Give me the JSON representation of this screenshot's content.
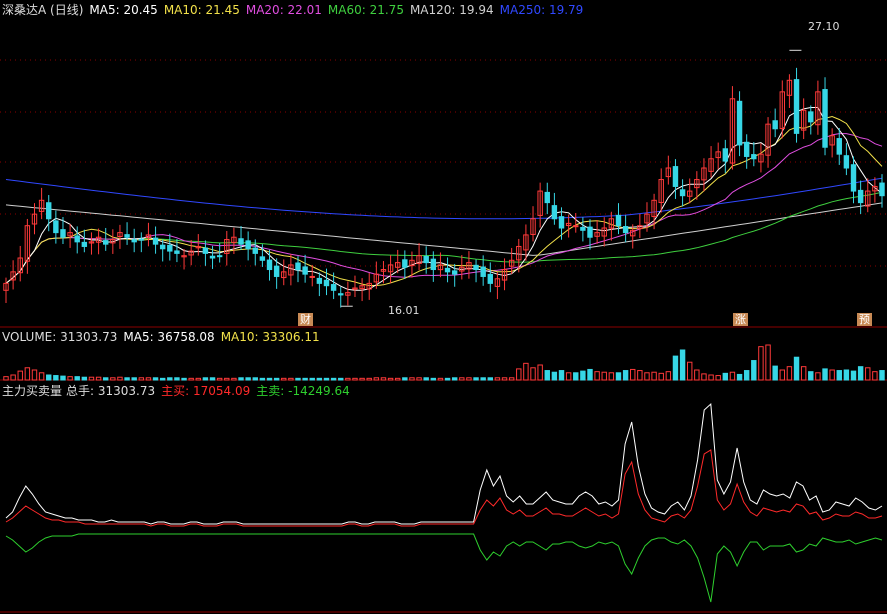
{
  "colors": {
    "bg": "#000000",
    "grid": "#8b0000",
    "up": "#ff3a3a",
    "down": "#37d7e6",
    "ma5": "#ffffff",
    "ma10": "#f2e14a",
    "ma20": "#e04ee0",
    "ma60": "#3fcf3f",
    "ma120": "#cfcfcf",
    "ma250": "#3048ff",
    "buy": "#ff2a2a",
    "sell": "#2ecf2e",
    "total": "#ffffff",
    "marker_bg": "#c88a55",
    "marker_text": "#ffffff"
  },
  "price_panel": {
    "title": "深桑达A (日线)",
    "ma5": "MA5: 20.45",
    "ma10": "MA10: 21.45",
    "ma20": "MA20: 22.01",
    "ma60": "MA60: 21.75",
    "ma120": "MA120: 19.94",
    "ma250": "MA250: 19.79",
    "high_label": "27.10",
    "low_label": "16.01",
    "markers": [
      "财",
      "涨",
      "预"
    ]
  },
  "volume_panel": {
    "label": "VOLUME: 31303.73",
    "ma5": "MA5: 36758.08",
    "ma10": "MA10: 33306.11"
  },
  "flow_panel": {
    "label": "主力买卖量",
    "total": "总手: 31303.73",
    "buy": "主买: 17054.09",
    "sell": "主卖: -14249.64"
  },
  "chart_data": [
    {
      "type": "candlestick",
      "title": "深桑达A (日线)",
      "approx_price_range": [
        15.5,
        28.5
      ],
      "close": [
        17.0,
        17.5,
        18.1,
        19.5,
        20.0,
        20.6,
        19.8,
        19.2,
        19.0,
        19.2,
        18.8,
        18.6,
        18.8,
        19.0,
        18.7,
        18.9,
        19.2,
        19.0,
        18.8,
        18.9,
        19.1,
        18.7,
        18.5,
        18.4,
        18.3,
        18.2,
        18.4,
        18.6,
        18.3,
        18.1,
        18.2,
        18.9,
        19.0,
        18.7,
        18.5,
        18.3,
        18.0,
        17.6,
        17.3,
        17.5,
        17.8,
        17.6,
        17.4,
        17.3,
        17.0,
        16.9,
        16.7,
        16.5,
        16.6,
        16.8,
        16.9,
        17.0,
        17.4,
        17.6,
        17.8,
        17.9,
        17.7,
        18.0,
        18.2,
        17.9,
        17.6,
        17.8,
        17.5,
        17.4,
        17.7,
        17.9,
        17.6,
        17.3,
        17.0,
        17.2,
        17.6,
        18.0,
        18.6,
        19.1,
        19.8,
        21.0,
        20.5,
        19.8,
        19.4,
        19.6,
        19.5,
        19.3,
        19.0,
        19.2,
        19.4,
        19.8,
        19.5,
        19.2,
        19.3,
        19.5,
        20.0,
        20.6,
        21.5,
        22.0,
        21.2,
        20.8,
        21.0,
        21.5,
        22.0,
        22.4,
        22.7,
        22.3,
        25.0,
        23.0,
        22.5,
        22.4,
        22.6,
        23.9,
        23.7,
        25.3,
        25.8,
        23.5,
        24.5,
        24.0,
        25.3,
        22.9,
        23.4,
        22.6,
        22.0,
        21.0,
        20.5,
        21.0,
        21.2,
        20.8
      ],
      "high_marker": 27.1,
      "low_marker": 16.01
    },
    {
      "type": "line",
      "title": "主力买卖量",
      "series": [
        {
          "name": "总手",
          "values": [
            6,
            9,
            16,
            22,
            18,
            13,
            9,
            8,
            7,
            6,
            6,
            5,
            5,
            5,
            4,
            4,
            5,
            4,
            4,
            4,
            4,
            4,
            3,
            4,
            4,
            3,
            3,
            3,
            4,
            4,
            3,
            3,
            3,
            4,
            4,
            4,
            3,
            3,
            3,
            3,
            3,
            3,
            3,
            3,
            3,
            3,
            3,
            3,
            3,
            3,
            3,
            3,
            4,
            4,
            3,
            3,
            4,
            4,
            4,
            4,
            3,
            3,
            3,
            4,
            4,
            4,
            4,
            4,
            4,
            4,
            4,
            4,
            20,
            30,
            22,
            27,
            17,
            14,
            17,
            13,
            13,
            16,
            19,
            15,
            14,
            13,
            13,
            17,
            19,
            17,
            13,
            14,
            12,
            15,
            43,
            54,
            32,
            18,
            11,
            9,
            8,
            12,
            14,
            10,
            17,
            35,
            60,
            63,
            25,
            18,
            24,
            41,
            24,
            15,
            13,
            20,
            18,
            17,
            18,
            16,
            24,
            22,
            15,
            17,
            9,
            10,
            14,
            13,
            12,
            16,
            14,
            11,
            10,
            12
          ]
        },
        {
          "name": "主买",
          "values": [
            4,
            6,
            9,
            12,
            10,
            8,
            6,
            5,
            5,
            4,
            4,
            4,
            3,
            3,
            3,
            3,
            3,
            3,
            3,
            3,
            3,
            3,
            2,
            3,
            3,
            2,
            2,
            2,
            3,
            3,
            2,
            2,
            2,
            3,
            3,
            3,
            2,
            2,
            2,
            2,
            2,
            2,
            2,
            2,
            2,
            2,
            2,
            2,
            2,
            2,
            2,
            2,
            3,
            3,
            2,
            2,
            3,
            3,
            3,
            3,
            2,
            2,
            2,
            3,
            3,
            3,
            3,
            3,
            3,
            3,
            3,
            3,
            10,
            15,
            12,
            16,
            10,
            8,
            10,
            7,
            7,
            9,
            11,
            8,
            8,
            7,
            7,
            9,
            11,
            9,
            7,
            8,
            6,
            8,
            28,
            34,
            18,
            10,
            6,
            5,
            4,
            7,
            8,
            6,
            10,
            22,
            38,
            40,
            15,
            10,
            13,
            23,
            14,
            9,
            7,
            11,
            10,
            9,
            10,
            9,
            13,
            12,
            8,
            9,
            5,
            6,
            8,
            7,
            7,
            9,
            8,
            6,
            6,
            7
          ]
        },
        {
          "name": "主卖",
          "values": [
            -3,
            -5,
            -8,
            -11,
            -9,
            -6,
            -4,
            -3,
            -3,
            -3,
            -3,
            -2,
            -2,
            -2,
            -2,
            -2,
            -2,
            -2,
            -2,
            -2,
            -2,
            -2,
            -2,
            -2,
            -2,
            -2,
            -2,
            -2,
            -2,
            -2,
            -2,
            -2,
            -2,
            -2,
            -2,
            -2,
            -2,
            -2,
            -2,
            -2,
            -2,
            -2,
            -2,
            -2,
            -2,
            -2,
            -2,
            -2,
            -2,
            -2,
            -2,
            -2,
            -2,
            -2,
            -2,
            -2,
            -2,
            -2,
            -2,
            -2,
            -2,
            -2,
            -2,
            -2,
            -2,
            -2,
            -2,
            -2,
            -2,
            -2,
            -2,
            -2,
            -10,
            -15,
            -11,
            -13,
            -8,
            -6,
            -8,
            -6,
            -6,
            -8,
            -10,
            -7,
            -7,
            -6,
            -6,
            -8,
            -9,
            -8,
            -6,
            -7,
            -6,
            -8,
            -17,
            -22,
            -14,
            -8,
            -5,
            -4,
            -4,
            -6,
            -7,
            -5,
            -8,
            -14,
            -24,
            -36,
            -12,
            -8,
            -11,
            -18,
            -11,
            -6,
            -6,
            -10,
            -8,
            -8,
            -8,
            -7,
            -11,
            -10,
            -7,
            -8,
            -4,
            -5,
            -6,
            -6,
            -5,
            -7,
            -6,
            -5,
            -4,
            -5
          ]
        }
      ]
    }
  ]
}
